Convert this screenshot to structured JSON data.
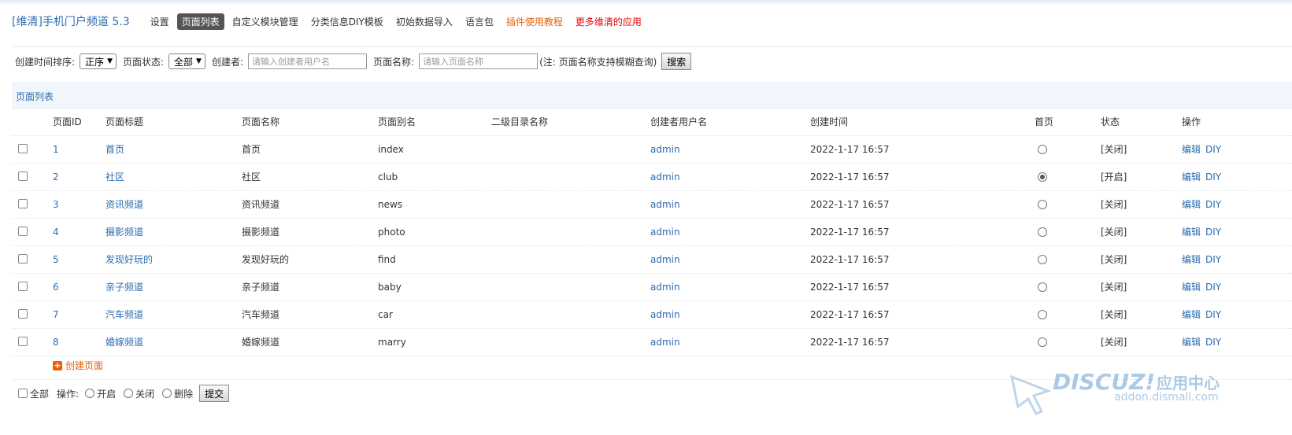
{
  "header": {
    "title": "[维清]手机门户频道 5.3",
    "nav": [
      {
        "label": "设置",
        "style": "normal"
      },
      {
        "label": "页面列表",
        "style": "active"
      },
      {
        "label": "自定义模块管理",
        "style": "normal"
      },
      {
        "label": "分类信息DIY模板",
        "style": "normal"
      },
      {
        "label": "初始数据导入",
        "style": "normal"
      },
      {
        "label": "语言包",
        "style": "normal"
      },
      {
        "label": "插件使用教程",
        "style": "orange"
      },
      {
        "label": "更多维清的应用",
        "style": "red"
      }
    ]
  },
  "filters": {
    "sort_label": "创建时间排序:",
    "sort_value": "正序",
    "status_label": "页面状态:",
    "status_value": "全部",
    "creator_label": "创建者:",
    "creator_placeholder": "请输入创建者用户名",
    "name_label": "页面名称:",
    "name_placeholder": "请输入页面名称",
    "note": "(注: 页面名称支持模糊查询)",
    "search_button": "搜索"
  },
  "section_title": "页面列表",
  "table": {
    "headers": {
      "id": "页面ID",
      "title": "页面标题",
      "name": "页面名称",
      "alias": "页面别名",
      "subdir": "二级目录名称",
      "creator": "创建者用户名",
      "created": "创建时间",
      "home": "首页",
      "status": "状态",
      "ops": "操作"
    },
    "rows": [
      {
        "id": "1",
        "title": "首页",
        "name": "首页",
        "alias": "index",
        "subdir": "",
        "creator": "admin",
        "created": "2022-1-17 16:57",
        "home": false,
        "status": "[关闭]",
        "edit": "编辑",
        "diy": "DIY"
      },
      {
        "id": "2",
        "title": "社区",
        "name": "社区",
        "alias": "club",
        "subdir": "",
        "creator": "admin",
        "created": "2022-1-17 16:57",
        "home": true,
        "status": "[开启]",
        "edit": "编辑",
        "diy": "DIY"
      },
      {
        "id": "3",
        "title": "资讯频道",
        "name": "资讯频道",
        "alias": "news",
        "subdir": "",
        "creator": "admin",
        "created": "2022-1-17 16:57",
        "home": false,
        "status": "[关闭]",
        "edit": "编辑",
        "diy": "DIY"
      },
      {
        "id": "4",
        "title": "摄影频道",
        "name": "摄影频道",
        "alias": "photo",
        "subdir": "",
        "creator": "admin",
        "created": "2022-1-17 16:57",
        "home": false,
        "status": "[关闭]",
        "edit": "编辑",
        "diy": "DIY"
      },
      {
        "id": "5",
        "title": "发现好玩的",
        "name": "发现好玩的",
        "alias": "find",
        "subdir": "",
        "creator": "admin",
        "created": "2022-1-17 16:57",
        "home": false,
        "status": "[关闭]",
        "edit": "编辑",
        "diy": "DIY"
      },
      {
        "id": "6",
        "title": "亲子频道",
        "name": "亲子频道",
        "alias": "baby",
        "subdir": "",
        "creator": "admin",
        "created": "2022-1-17 16:57",
        "home": false,
        "status": "[关闭]",
        "edit": "编辑",
        "diy": "DIY"
      },
      {
        "id": "7",
        "title": "汽车频道",
        "name": "汽车频道",
        "alias": "car",
        "subdir": "",
        "creator": "admin",
        "created": "2022-1-17 16:57",
        "home": false,
        "status": "[关闭]",
        "edit": "编辑",
        "diy": "DIY"
      },
      {
        "id": "8",
        "title": "婚嫁频道",
        "name": "婚嫁频道",
        "alias": "marry",
        "subdir": "",
        "creator": "admin",
        "created": "2022-1-17 16:57",
        "home": false,
        "status": "[关闭]",
        "edit": "编辑",
        "diy": "DIY"
      }
    ]
  },
  "create_page": "创建页面",
  "bottom": {
    "select_all": "全部",
    "ops_label": "操作:",
    "open": "开启",
    "close": "关闭",
    "delete": "删除",
    "submit": "提交"
  },
  "watermark": {
    "brand": "DISCUZ!",
    "suffix": "应用中心",
    "url": "addon.dismall.com"
  },
  "colors": {
    "link": "#2b6cb0",
    "orange": "#e8600a",
    "red": "#ee0000",
    "section_bg": "#f1f6fc"
  }
}
